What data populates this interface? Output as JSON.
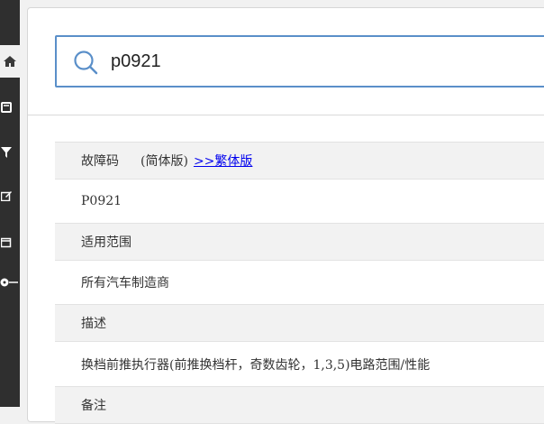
{
  "search": {
    "query": "p0921"
  },
  "table": {
    "rows": [
      {
        "kind": "header",
        "label": "故障码",
        "version": "(简体版)",
        "link": ">>繁体版"
      },
      {
        "kind": "value",
        "text": "P0921"
      },
      {
        "kind": "header",
        "label": "适用范围"
      },
      {
        "kind": "value",
        "text": "所有汽车制造商"
      },
      {
        "kind": "header",
        "label": "描述"
      },
      {
        "kind": "value",
        "text": "换档前推执行器(前推换档杆，奇数齿轮，1,3,5)电路范围/性能"
      },
      {
        "kind": "header",
        "label": "备注"
      }
    ]
  },
  "colors": {
    "sidebar": "#2f2f2f",
    "accent_border": "#5a8fc9",
    "link": "#0000ee",
    "header_row_bg": "#f2f2f2"
  },
  "sidebar": {
    "icons": [
      "home-icon",
      "book-icon",
      "filter-icon",
      "edit-icon",
      "window-icon",
      "toggle-icon"
    ]
  }
}
